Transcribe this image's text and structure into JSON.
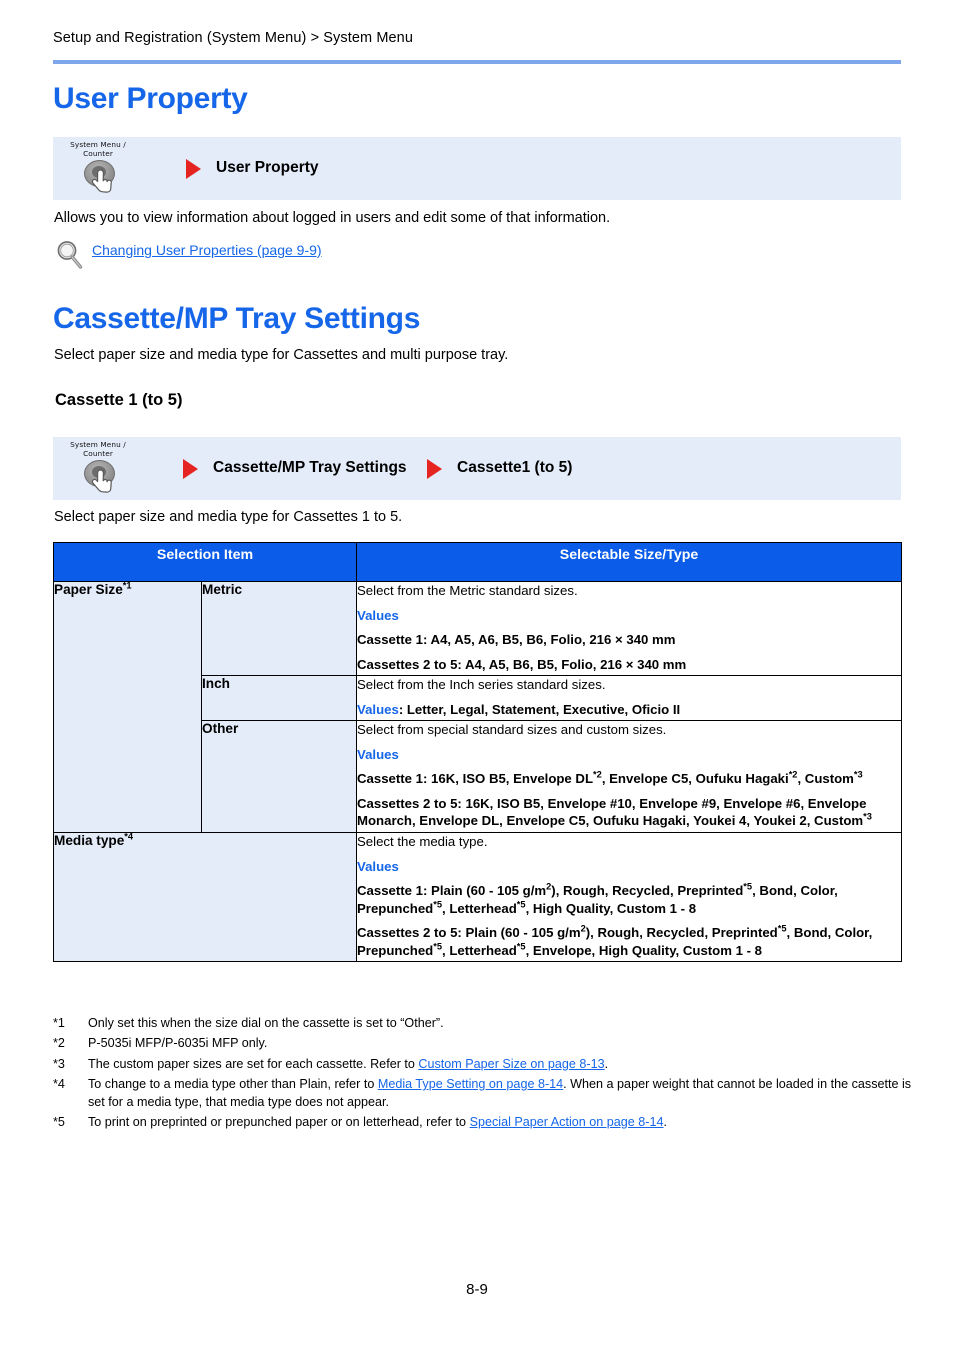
{
  "header": {
    "breadcrumb": "Setup and Registration (System Menu) > System Menu"
  },
  "sections": {
    "user_property": {
      "heading": "User Property",
      "nav": {
        "key_label_line1": "System Menu /",
        "key_label_line2": "Counter",
        "step1": "User Property"
      },
      "description": "Allows you to view information about logged in users and edit some of that information.",
      "reference_link": "Changing User Properties (page 9-9)"
    },
    "cassette_mp_tray": {
      "heading": "Cassette/MP Tray Settings",
      "intro": "Select paper size and media type for Cassettes and multi purpose tray.",
      "subheading": "Cassette 1 (to 5)",
      "nav": {
        "key_label_line1": "System Menu /",
        "key_label_line2": "Counter",
        "step1": "Cassette/MP Tray Settings",
        "step2": "Cassette1 (to 5)"
      },
      "sub_intro": "Select paper size and media type for Cassettes 1 to 5."
    }
  },
  "table": {
    "headers": [
      "Selection Item",
      "Selectable Size/Type"
    ],
    "rows": [
      {
        "item": "Paper Size",
        "item_sup": "*1",
        "sub": "Metric",
        "lines": [
          {
            "kind": "plain",
            "text": "Select from the Metric standard sizes."
          },
          {
            "kind": "values_label",
            "text": "Values"
          },
          {
            "kind": "bold",
            "text": "Cassette 1: A4, A5, A6, B5, B6, Folio, 216 × 340 mm"
          },
          {
            "kind": "bold",
            "text": "Cassettes 2 to 5: A4, A5, B6, B5, Folio, 216 × 340 mm"
          }
        ]
      },
      {
        "sub": "Inch",
        "lines": [
          {
            "kind": "plain",
            "text": "Select from the Inch series standard sizes."
          },
          {
            "kind": "values_inline",
            "label": "Values",
            "text": ": Letter, Legal, Statement, Executive, Oficio II"
          }
        ]
      },
      {
        "sub": "Other",
        "lines": [
          {
            "kind": "plain",
            "text": "Select from special standard sizes and custom sizes."
          },
          {
            "kind": "values_label",
            "text": "Values"
          },
          {
            "kind": "bold_sup",
            "html": "Cassette 1: 16K, ISO B5, Envelope DL<sup>*2</sup>, Envelope C5, Oufuku Hagaki<sup>*2</sup>, Custom<sup>*3</sup>"
          },
          {
            "kind": "bold_sup",
            "html": "Cassettes 2 to 5: 16K, ISO B5, Envelope #10, Envelope #9, Envelope #6, Envelope Monarch, Envelope DL, Envelope C5, Oufuku Hagaki, Youkei 4, Youkei 2, Custom<sup>*3</sup>"
          }
        ]
      },
      {
        "item": "Media type",
        "item_sup": "*4",
        "lines": [
          {
            "kind": "plain",
            "text": "Select the media type."
          },
          {
            "kind": "values_label",
            "text": "Values"
          },
          {
            "kind": "bold_sup",
            "html": "Cassette 1: Plain (60 - 105 g/m<sup>2</sup>), Rough, Recycled, Preprinted<sup>*5</sup>, Bond, Color, Prepunched<sup>*5</sup>, Letterhead<sup>*5</sup>, High Quality, Custom 1 - 8"
          },
          {
            "kind": "bold_sup",
            "html": "Cassettes 2 to 5: Plain (60 - 105 g/m<sup>2</sup>), Rough, Recycled, Preprinted<sup>*5</sup>, Bond, Color, Prepunched<sup>*5</sup>, Letterhead<sup>*5</sup>, Envelope, High Quality, Custom 1 - 8"
          }
        ]
      }
    ]
  },
  "footnotes": [
    {
      "mark": "*1",
      "text": "Only set this when the size dial on the cassette is set to “Other”.",
      "link": "",
      "text_after": ""
    },
    {
      "mark": "*2",
      "text": "P-5035i MFP/P-6035i MFP only.",
      "link": "",
      "text_after": ""
    },
    {
      "mark": "*3",
      "text": "The custom paper sizes are set for each cassette. Refer to ",
      "link": "Custom Paper Size on page 8-13",
      "text_after": "."
    },
    {
      "mark": "*4",
      "text": "To change to a media type other than Plain, refer to ",
      "link": "Media Type Setting on page 8-14",
      "text_after": ". When a paper weight that cannot be loaded in the cassette is set for a media type, that media type does not appear."
    },
    {
      "mark": "*5",
      "text": "To print on preprinted or prepunched paper or on letterhead, refer to ",
      "link": "Special Paper Action on page 8-14",
      "text_after": "."
    }
  ],
  "footer": {
    "page_number": "8-9"
  },
  "colors": {
    "heading_blue": "#1566E8",
    "table_header_blue": "#0B5CE8",
    "navbox_bg": "#E4EBF9",
    "arrow_red": "#E52421",
    "rule_blue": "#7DA7EA"
  }
}
